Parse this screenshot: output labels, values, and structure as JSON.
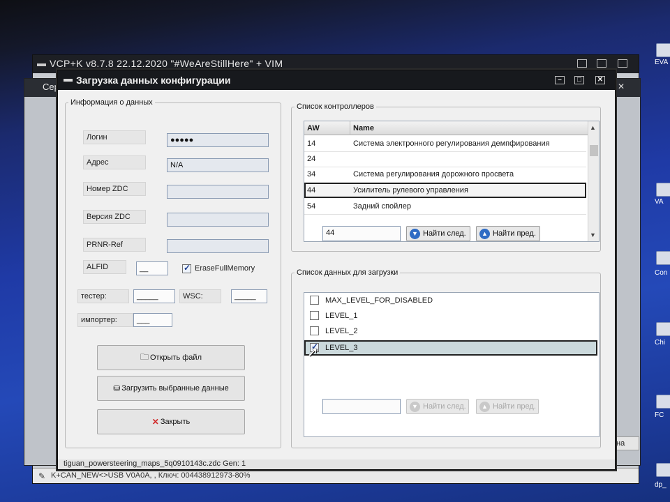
{
  "vcp_window": {
    "title": "VCP+K v8.7.8 22.12.2020 \"#WeAreStillHere\" + VIM",
    "status": "K+CAN_NEW<>USB V0A0A, , Ключ: 004438912973-80%",
    "right_button": "на"
  },
  "bg_window": {
    "title": "Сер"
  },
  "desktop": {
    "labels": [
      "EVA",
      "VA",
      "Con",
      "Chi",
      "FC",
      "dp_"
    ]
  },
  "dialog": {
    "title": "Загрузка данных конфигурации",
    "status": "tiguan_powersteering_maps_5q0910143c.zdc Gen: 1",
    "info_group": {
      "legend": "Информация о данных",
      "login_label": "Логин",
      "login_value": "●●●●●",
      "address_label": "Адрес",
      "address_value": "N/A",
      "zdc_number_label": "Номер ZDC",
      "zdc_number_value": "",
      "zdc_version_label": "Версия ZDC",
      "zdc_version_value": "",
      "prnr_label": "PRNR-Ref",
      "prnr_value": "",
      "alfid_label": "ALFID",
      "alfid_value": "__",
      "erase_label": "EraseFullMemory",
      "erase_checked": true,
      "tester_label": "тестер:",
      "tester_value": "_____",
      "wsc_label": "WSC:",
      "wsc_value": "_____",
      "importer_label": "импортер:",
      "importer_value": "___"
    },
    "buttons": {
      "open_file": "Открыть файл",
      "load_selected": "Загрузить выбранные данные",
      "close": "Закрыть"
    },
    "controllers_group": {
      "legend": "Список контроллеров",
      "columns": [
        "AW",
        "Name"
      ],
      "rows": [
        {
          "aw": "14",
          "name": "Система электронного регулирования демпфирования"
        },
        {
          "aw": "24",
          "name": ""
        },
        {
          "aw": "34",
          "name": "Система регулирования дорожного просвета"
        },
        {
          "aw": "44",
          "name": "Усилитель рулевого управления"
        },
        {
          "aw": "54",
          "name": "Задний спойлер"
        }
      ],
      "selected_index": 3,
      "search_value": "44",
      "find_next": "Найти след.",
      "find_prev": "Найти пред."
    },
    "data_group": {
      "legend": "Список данных для загрузки",
      "items": [
        {
          "label": "MAX_LEVEL_FOR_DISABLED",
          "checked": false
        },
        {
          "label": "LEVEL_1",
          "checked": false
        },
        {
          "label": "LEVEL_2",
          "checked": false
        },
        {
          "label": "LEVEL_3",
          "checked": true
        }
      ],
      "selected_index": 3,
      "search_value": "",
      "find_next": "Найти след.",
      "find_prev": "Найти пред."
    }
  },
  "colors": {
    "desktop_blue": "#1f3aa6",
    "title_bar": "#17191d",
    "selection_highlight": "#cbd9dc",
    "find_button_icon": "#2f6cc4"
  },
  "icons": {
    "open_file": "folder-icon",
    "load": "load-data-icon",
    "close": "red-x-icon",
    "find_next": "arrow-down-icon",
    "find_prev": "arrow-up-icon",
    "status": "plug-icon"
  }
}
